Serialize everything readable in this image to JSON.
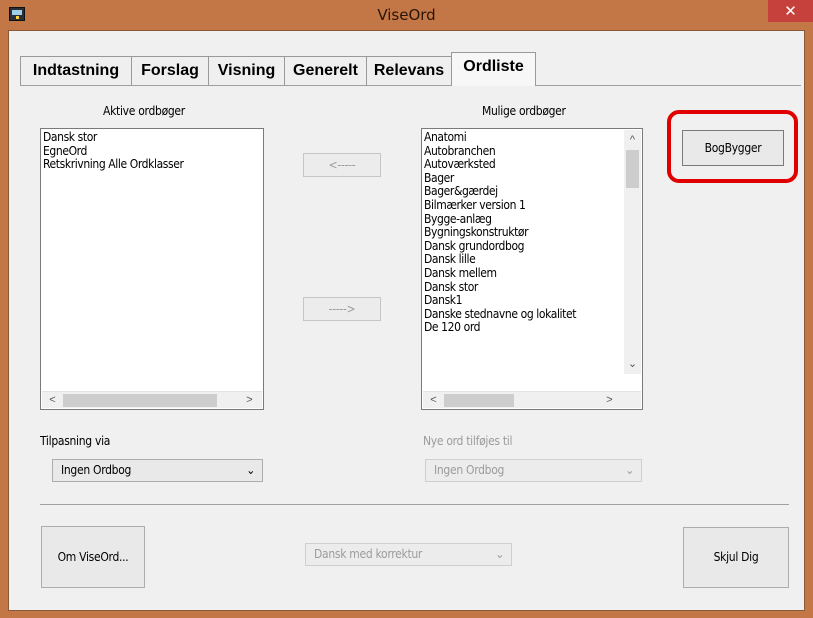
{
  "window": {
    "title": "ViseOrd",
    "close_glyph": "✕"
  },
  "tabs": [
    {
      "label": "Indtastning"
    },
    {
      "label": "Forslag"
    },
    {
      "label": "Visning"
    },
    {
      "label": "Generelt"
    },
    {
      "label": "Relevans"
    },
    {
      "label": "Ordliste"
    }
  ],
  "active_tab": "Ordliste",
  "active_dicts": {
    "label": "Aktive ordbøger",
    "items": [
      "Dansk stor",
      "EgneOrd",
      "Retskrivning Alle Ordklasser"
    ]
  },
  "possible_dicts": {
    "label": "Mulige ordbøger",
    "items": [
      "Anatomi",
      "Autobranchen",
      "Autoværksted",
      "Bager",
      "Bager&gærdej",
      "Bilmærker version 1",
      "Bygge-anlæg",
      "Bygningskonstruktør",
      "Dansk grundordbog",
      "Dansk lille",
      "Dansk mellem",
      "Dansk stor",
      "Dansk1",
      "Danske stednavne og lokalitet",
      "De 120 ord"
    ]
  },
  "move_buttons": {
    "left": "<-----",
    "right": "----->"
  },
  "bogbygger_label": "BogBygger",
  "tilpasning": {
    "label": "Tilpasning via",
    "value": "Ingen Ordbog"
  },
  "nye_ord": {
    "label": "Nye ord tilføjes til",
    "value": "Ingen Ordbog"
  },
  "footer": {
    "om_label": "Om ViseOrd...",
    "language_value": "Dansk med korrektur",
    "skjul_label": "Skjul Dig"
  },
  "colors": {
    "title_bar": "#c37646",
    "close_button": "#c7413c",
    "highlight": "#e00000"
  },
  "icons": {
    "chevron": "⌄",
    "scroll_left": "<",
    "scroll_right": ">",
    "scroll_up": "^"
  }
}
